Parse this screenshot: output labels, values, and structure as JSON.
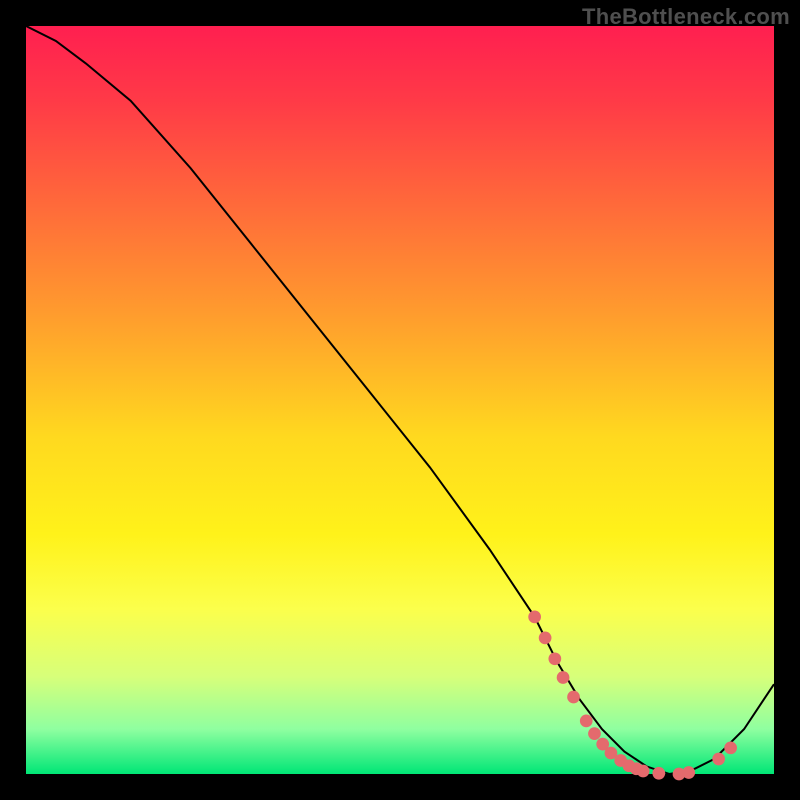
{
  "watermark": "TheBottleneck.com",
  "chart_data": {
    "type": "line",
    "title": "",
    "xlabel": "",
    "ylabel": "",
    "xlim": [
      0,
      100
    ],
    "ylim": [
      0,
      100
    ],
    "series": [
      {
        "name": "bottleneck-curve",
        "x": [
          0,
          4,
          8,
          14,
          22,
          30,
          38,
          46,
          54,
          62,
          68,
          71,
          74,
          77,
          80,
          83,
          86,
          89,
          92,
          96,
          100
        ],
        "y": [
          100,
          98,
          95,
          90,
          81,
          71,
          61,
          51,
          41,
          30,
          21,
          15,
          10,
          6,
          3,
          1,
          0,
          0.5,
          2,
          6,
          12
        ]
      }
    ],
    "markers": {
      "name": "optimal-range-dots",
      "color": "#e46a6d",
      "x": [
        68,
        69.4,
        70.7,
        71.8,
        73.2,
        74.9,
        76,
        77.1,
        78.2,
        79.5,
        80.6,
        81.6,
        82.5,
        84.6,
        87.3,
        88.6,
        92.6,
        94.2
      ],
      "y": [
        21,
        18.2,
        15.4,
        12.9,
        10.3,
        7.1,
        5.4,
        4.0,
        2.8,
        1.8,
        1.1,
        0.7,
        0.4,
        0.1,
        0.0,
        0.2,
        2.0,
        3.5
      ]
    }
  }
}
